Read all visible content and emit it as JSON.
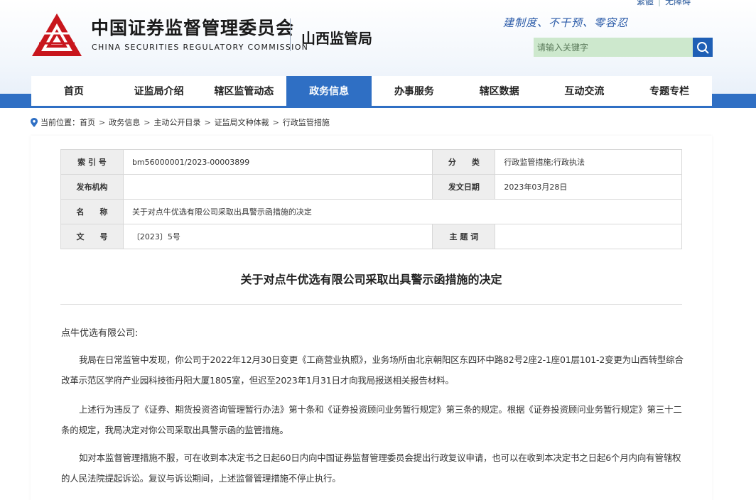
{
  "header": {
    "top_links": [
      "繁體",
      "无障碍"
    ],
    "site_title_cn": "中国证券监督管理委员会",
    "site_title_en": "CHINA SECURITIES REGULATORY COMMISSION",
    "bureau_name": "山西监管局",
    "slogan": "建制度、不干预、零容忍",
    "search_placeholder": "请输入关键字",
    "colors": {
      "brand_red": "#c8161d",
      "nav_blue": "#2f6fc4",
      "search_green": "#cde8cd"
    }
  },
  "nav": {
    "items": [
      "首页",
      "证监局介绍",
      "辖区监管动态",
      "政务信息",
      "办事服务",
      "辖区数据",
      "互动交流",
      "专题专栏"
    ],
    "active_index": 3
  },
  "breadcrumb": {
    "prefix": "当前位置：",
    "items": [
      "首页",
      "政务信息",
      "主动公开目录",
      "证监局文种体裁",
      "行政监管措施"
    ]
  },
  "meta": {
    "index_label": "索 引 号",
    "index_value": "bm56000001/2023-00003899",
    "category_label": "分　　类",
    "category_value": "行政监管措施;行政执法",
    "publisher_label": "发布机构",
    "publisher_value": "",
    "date_label": "发文日期",
    "date_value": "2023年03月28日",
    "name_label": "名　　称",
    "name_value": "关于对点牛优选有限公司采取出具警示函措施的决定",
    "docno_label": "文　　号",
    "docno_value": "〔2023〕5号",
    "keywords_label": "主 题 词",
    "keywords_value": ""
  },
  "document": {
    "title": "关于对点牛优选有限公司采取出具警示函措施的决定",
    "salutation": "点牛优选有限公司:",
    "paragraphs": [
      "我局在日常监管中发现，你公司于2022年12月30日变更《工商营业执照》，业务场所由北京朝阳区东四环中路82号2座2-1座01层101-2变更为山西转型综合改革示范区学府产业园科技街丹阳大厦1805室，但迟至2023年1月31日才向我局报送相关报告材料。",
      "上述行为违反了《证券、期货投资咨询管理暂行办法》第十条和《证券投资顾问业务暂行规定》第三条的规定。根据《证券投资顾问业务暂行规定》第三十二条的规定，我局决定对你公司采取出具警示函的监管措施。",
      "如对本监督管理措施不服，可在收到本决定书之日起60日内向中国证券监督管理委员会提出行政复议申请，也可以在收到本决定书之日起6个月内向有管辖权的人民法院提起诉讼。复议与诉讼期间，上述监督管理措施不停止执行。"
    ]
  }
}
